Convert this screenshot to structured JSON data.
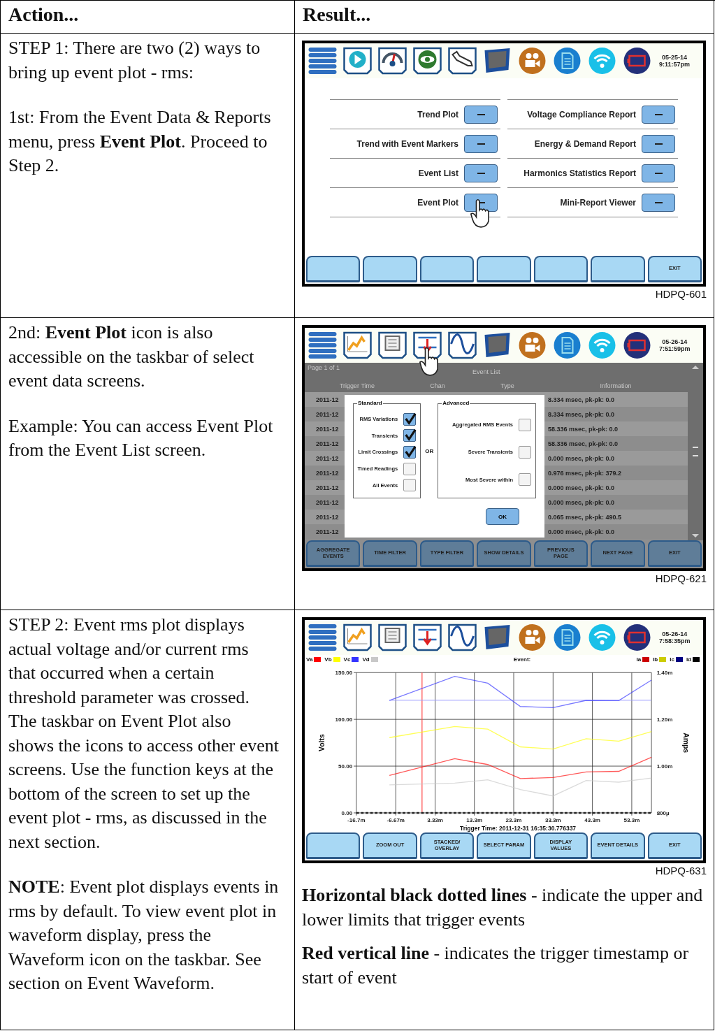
{
  "table": {
    "columns": [
      "Action...",
      "Result..."
    ],
    "rows": [
      {
        "action": [
          "STEP 1: There are two (2) ways to bring up event plot - rms:",
          "1st: From the Event Data & Reports menu, press **Event Plot**. Proceed to Step 2."
        ],
        "screen": {
          "kind": "menu",
          "taskbar": {
            "icons": [
              {
                "kind": "menu",
                "pointed": false
              },
              {
                "kind": "play",
                "pointed": false
              },
              {
                "kind": "gauge",
                "pointed": false
              },
              {
                "kind": "eye",
                "pointed": false
              },
              {
                "kind": "wrench",
                "pointed": false
              },
              {
                "kind": "monitor",
                "pointed": false
              },
              {
                "kind": "camera",
                "pointed": false
              },
              {
                "kind": "document",
                "pointed": false
              },
              {
                "kind": "wifi",
                "pointed": false
              },
              {
                "kind": "battery",
                "pointed": false
              }
            ],
            "date": "05-25-14",
            "time": "9:11:57pm"
          },
          "menu_columns": [
            [
              {
                "label": "Trend Plot",
                "pointed": false
              },
              {
                "label": "Trend with Event Markers",
                "pointed": false
              },
              {
                "label": "Event List",
                "pointed": false
              },
              {
                "label": "Event Plot",
                "pointed": true
              }
            ],
            [
              {
                "label": "Voltage Compliance Report",
                "pointed": false
              },
              {
                "label": "Energy & Demand Report",
                "pointed": false
              },
              {
                "label": "Harmonics Statistics Report",
                "pointed": false
              },
              {
                "label": "Mini-Report Viewer",
                "pointed": false
              }
            ]
          ],
          "keys": [
            {
              "kind": "blank"
            },
            {
              "kind": "blank"
            },
            {
              "kind": "blank"
            },
            {
              "kind": "blank"
            },
            {
              "kind": "blank"
            },
            {
              "kind": "blank"
            },
            {
              "kind": "label",
              "label": "EXIT"
            }
          ]
        },
        "caption": "HDPQ-601"
      },
      {
        "action": [
          "2nd: **Event Plot** icon is also accessible on the taskbar of select event data screens.",
          "Example: You can access Event Plot from the Event List screen."
        ],
        "screen": {
          "kind": "event_list",
          "taskbar": {
            "icons": [
              {
                "kind": "menu",
                "pointed": false
              },
              {
                "kind": "trend",
                "pointed": false
              },
              {
                "kind": "scroll",
                "pointed": false
              },
              {
                "kind": "plot",
                "pointed": true
              },
              {
                "kind": "wave",
                "pointed": false
              },
              {
                "kind": "monitor",
                "pointed": false
              },
              {
                "kind": "camera",
                "pointed": false
              },
              {
                "kind": "document",
                "pointed": false
              },
              {
                "kind": "wifi",
                "pointed": false
              },
              {
                "kind": "battery",
                "pointed": false
              }
            ],
            "date": "05-26-14",
            "time": "7:51:59pm"
          },
          "page": "Page 1 of 1",
          "title": "Event List",
          "columns": [
            "Trigger Time",
            "Chan",
            "Type",
            "Information"
          ],
          "rows": [
            {
              "trigger_time": "2011-12",
              "information": "8.334 msec, pk-pk: 0.0"
            },
            {
              "trigger_time": "2011-12",
              "information": "8.334 msec, pk-pk: 0.0"
            },
            {
              "trigger_time": "2011-12",
              "information": "58.336 msec, pk-pk: 0.0"
            },
            {
              "trigger_time": "2011-12",
              "information": "58.336 msec, pk-pk: 0.0"
            },
            {
              "trigger_time": "2011-12",
              "information": "0.000 msec, pk-pk: 0.0"
            },
            {
              "trigger_time": "2011-12",
              "information": "0.976 msec, pk-pk: 379.2"
            },
            {
              "trigger_time": "2011-12",
              "information": "0.000 msec, pk-pk: 0.0"
            },
            {
              "trigger_time": "2011-12",
              "information": "0.000 msec, pk-pk: 0.0"
            },
            {
              "trigger_time": "2011-12",
              "information": "0.065 msec, pk-pk: 490.5"
            },
            {
              "trigger_time": "2011-12",
              "information": "0.000 msec, pk-pk: 0.0"
            }
          ],
          "dialog": {
            "groups": [
              {
                "title": "Standard",
                "options": [
                  {
                    "label": "RMS Variations",
                    "checked": true
                  },
                  {
                    "label": "Transients",
                    "checked": true
                  },
                  {
                    "label": "Limit Crossings",
                    "checked": true
                  },
                  {
                    "label": "Timed Readings",
                    "checked": false
                  },
                  {
                    "label": "All Events",
                    "checked": false
                  }
                ]
              },
              {
                "title": "Advanced",
                "options": [
                  {
                    "label": "Aggregated RMS Events",
                    "checked": false
                  },
                  {
                    "label": "Severe Transients",
                    "checked": false
                  },
                  {
                    "label": "Most Severe within",
                    "checked": false
                  }
                ]
              }
            ],
            "separator": "OR",
            "ok": "OK"
          },
          "keys": [
            {
              "kind": "label",
              "label": "AGGREGATE EVENTS"
            },
            {
              "kind": "label",
              "label": "TIME FILTER"
            },
            {
              "kind": "label",
              "label": "TYPE FILTER"
            },
            {
              "kind": "label",
              "label": "SHOW DETAILS"
            },
            {
              "kind": "label",
              "label": "PREVIOUS PAGE"
            },
            {
              "kind": "label",
              "label": "NEXT PAGE"
            },
            {
              "kind": "label",
              "label": "EXIT"
            }
          ]
        },
        "caption": "HDPQ-621"
      },
      {
        "action": [
          "STEP 2: Event rms plot displays actual voltage and/or current rms that occurred when a certain threshold parameter was crossed. The taskbar on Event Plot also shows the icons to access other event screens. Use the function keys at the bottom of the screen to set up the event plot - rms, as discussed in the next section.",
          "**NOTE**: Event plot displays events in rms by default. To view event plot in waveform display, press the Waveform icon on the taskbar. See section on Event Waveform."
        ],
        "screen": {
          "kind": "plot",
          "taskbar": {
            "icons": [
              {
                "kind": "menu",
                "pointed": false
              },
              {
                "kind": "trend",
                "pointed": false
              },
              {
                "kind": "scroll",
                "pointed": false
              },
              {
                "kind": "plot",
                "pointed": false
              },
              {
                "kind": "wave",
                "pointed": false
              },
              {
                "kind": "monitor",
                "pointed": false
              },
              {
                "kind": "camera",
                "pointed": false
              },
              {
                "kind": "document",
                "pointed": false
              },
              {
                "kind": "wifi",
                "pointed": false
              },
              {
                "kind": "battery",
                "pointed": false
              }
            ],
            "date": "05-26-14",
            "time": "7:58:35pm"
          },
          "event_label": "Event:",
          "legend_right": [
            {
              "name": "Ia",
              "color": "#cc0000"
            },
            {
              "name": "Ib",
              "color": "#cccc00"
            },
            {
              "name": "Ic",
              "color": "#000080"
            },
            {
              "name": "Id",
              "color": "#000000"
            }
          ],
          "chart_data": {
            "type": "line",
            "ylabel": "Volts",
            "x": [
              -8.3,
              8.3,
              16.7,
              25,
              33.3,
              41.7,
              50,
              58.3
            ],
            "series": [
              {
                "name": "Va",
                "color": "#ff0000",
                "values": [
                  40,
                  58,
                  51.7,
                  36.7,
                  37.8,
                  43.8,
                  44.4,
                  59.5
                ]
              },
              {
                "name": "Vb",
                "color": "#ffff00",
                "values": [
                  80.5,
                  92.3,
                  89.6,
                  70.6,
                  68.2,
                  79.3,
                  76.6,
                  87
                ]
              },
              {
                "name": "Vc",
                "color": "#3333ff",
                "values": [
                  120.3,
                  146,
                  138.7,
                  113.8,
                  112.5,
                  120.3,
                  120,
                  142
                ]
              },
              {
                "name": "Vd",
                "color": "#c8c8c8",
                "values": [
                  30,
                  31.8,
                  35.4,
                  24.9,
                  18.1,
                  34.6,
                  32.8,
                  37.3
                ]
              }
            ],
            "grid": true,
            "xlim": [
              -16.7,
              58.3
            ],
            "ylim": [
              0,
              150
            ],
            "xticks": [
              {
                "value": -16.7,
                "label": "-16.7m"
              },
              {
                "value": -6.67,
                "label": "-6.67m"
              },
              {
                "value": 3.33,
                "label": "3.33m"
              },
              {
                "value": 13.3,
                "label": "13.3m"
              },
              {
                "value": 23.3,
                "label": "23.3m"
              },
              {
                "value": 33.3,
                "label": "33.3m"
              },
              {
                "value": 43.3,
                "label": "43.3m"
              },
              {
                "value": 53.3,
                "label": "53.3m"
              }
            ],
            "yticks": [
              {
                "value": 0,
                "label": "0.00"
              },
              {
                "value": 50,
                "label": "50.00"
              },
              {
                "value": 100,
                "label": "100.00"
              },
              {
                "value": 150,
                "label": "150.00"
              }
            ],
            "ref_lines": [
              {
                "axis": "x",
                "value": 0,
                "color": "#ff4040"
              },
              {
                "axis": "y",
                "value": 0,
                "color": "#222222"
              },
              {
                "axis": "y",
                "value": 120.5,
                "color": "#9a9aff"
              }
            ]
          },
          "right_axis": {
            "label": "Amps",
            "ticks": [
              "1.40m",
              "1.20m",
              "1.00m",
              "800µ"
            ]
          },
          "trigger_time": "Trigger Time: 2011-12-31 16:35:30.776337",
          "keys": [
            {
              "kind": "blank"
            },
            {
              "kind": "label",
              "label": "ZOOM OUT"
            },
            {
              "kind": "label",
              "label": "STACKED/ OVERLAY"
            },
            {
              "kind": "label",
              "label": "SELECT PARAM"
            },
            {
              "kind": "label",
              "label": "DISPLAY VALUES"
            },
            {
              "kind": "label",
              "label": "EVENT DETAILS"
            },
            {
              "kind": "label",
              "label": "EXIT"
            }
          ]
        },
        "caption": "HDPQ-631",
        "notes": [
          "**Horizontal black dotted lines** - indicate the upper and lower limits that trigger events",
          "**Red vertical line** - indicates the trigger timestamp or start of event"
        ]
      }
    ]
  }
}
